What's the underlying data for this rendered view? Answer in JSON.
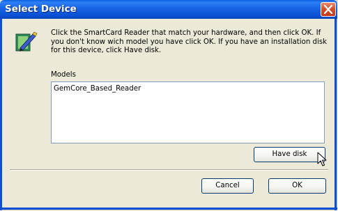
{
  "window": {
    "title": "Select Device",
    "icons": {
      "close": "close-icon",
      "wizard": "hardware-wizard-icon",
      "cursor": "mouse-pointer-icon"
    }
  },
  "instructions": "Click the SmartCard Reader that match your hardware, and then click OK. If you don't know wich model you have click OK. If you have an installation disk for this device, click Have disk.",
  "models": {
    "label": "Models",
    "items": [
      "GemCore_Based_Reader"
    ]
  },
  "buttons": {
    "have_disk": "Have disk",
    "cancel": "Cancel",
    "ok": "OK"
  },
  "colors": {
    "titlebar": "#0a4fd3",
    "dialog_bg": "#ece9d8",
    "close_button": "#d5502a",
    "button_border": "#003c74"
  }
}
